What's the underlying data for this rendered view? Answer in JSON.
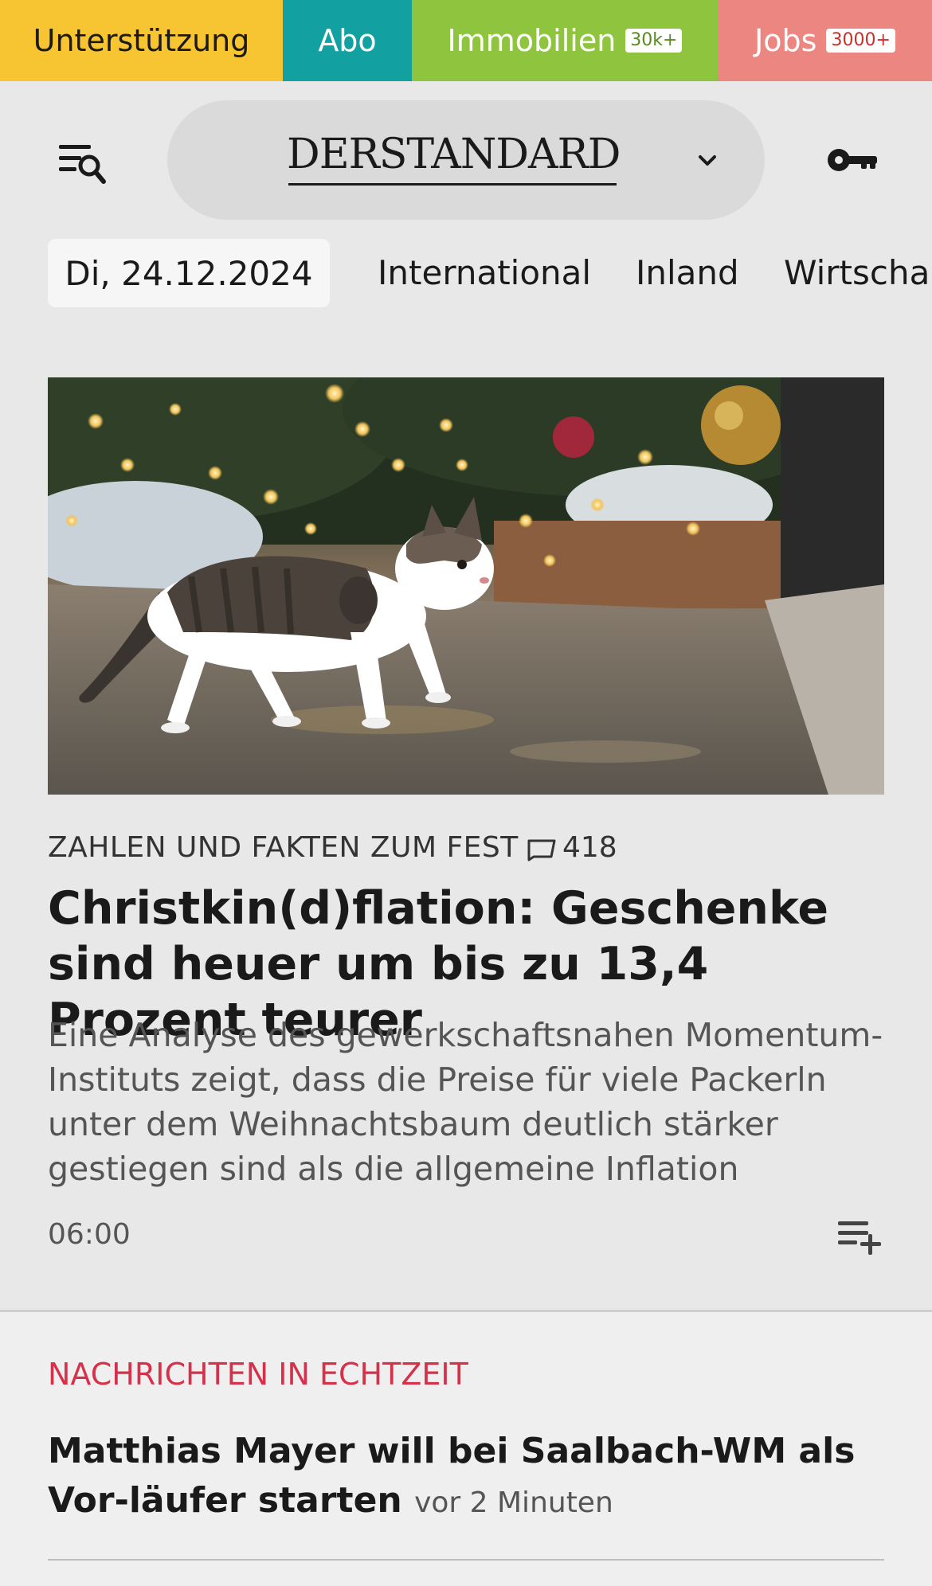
{
  "topbar": {
    "support": "Unterstützung",
    "abo": "Abo",
    "immobilien": "Immobilien",
    "immobilien_badge": "30k+",
    "jobs": "Jobs",
    "jobs_badge": "3000+"
  },
  "header": {
    "logo": "DERSTANDARD"
  },
  "nav": {
    "date": "Di, 24.12.2024",
    "items": [
      "International",
      "Inland",
      "Wirtscha"
    ]
  },
  "article": {
    "kicker": "ZAHLEN UND FAKTEN ZUM FEST",
    "comments": "418",
    "headline": "Christkin(d)flation: Geschenke sind heuer um bis zu 13,4 Prozent teurer",
    "teaser": "Eine Analyse des gewerkschaftsnahen Momentum-Instituts zeigt, dass die Preise für viele Packerln unter dem Weihnachtsbaum deutlich stärker gestiegen sind als die allgemeine Inflation",
    "time": "06:00"
  },
  "live": {
    "title": "NACHRICHTEN IN ECHTZEIT",
    "headline": "Matthias Mayer will bei Saalbach-WM als Vor-läufer starten",
    "meta": "vor 2 Minuten"
  },
  "icons": {
    "menu": "menu-search-icon",
    "chevron": "chevron-down-icon",
    "key": "key-icon",
    "comment": "comment-icon",
    "add": "add-to-list-icon"
  },
  "colors": {
    "support": "#f7c531",
    "abo": "#13a0a1",
    "immobilien": "#8fc43f",
    "jobs": "#ec8681",
    "accent_red": "#d6314a"
  }
}
